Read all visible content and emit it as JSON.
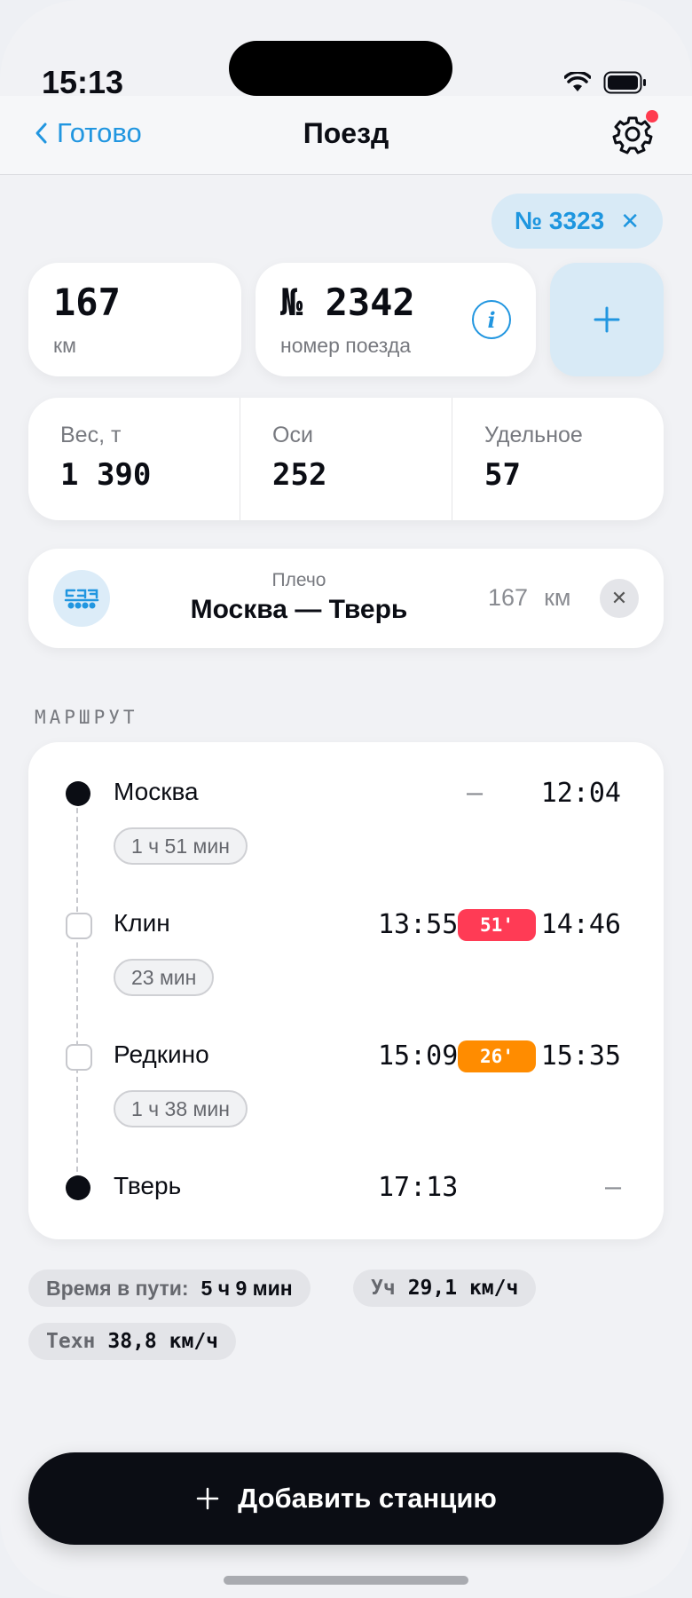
{
  "status": {
    "time": "15:13"
  },
  "nav": {
    "back_label": "Готово",
    "title": "Поезд"
  },
  "train_chip": {
    "label": "№ 3323"
  },
  "distance": {
    "value": "167",
    "unit": "км"
  },
  "train_number": {
    "value": "№ 2342",
    "label": "номер поезда"
  },
  "stats": [
    {
      "label": "Вес, т",
      "value": "1 390"
    },
    {
      "label": "Оси",
      "value": "252"
    },
    {
      "label": "Удельное",
      "value": "57"
    }
  ],
  "shoulder": {
    "caption": "Плечо",
    "route": "Москва — Тверь",
    "distance": "167",
    "unit": "км"
  },
  "route_section_label": "МАРШРУТ",
  "stops": [
    {
      "name": "Москва",
      "arrival": "—",
      "departure": "12:04",
      "marker": "filled"
    },
    {
      "name": "Клин",
      "arrival": "13:55",
      "stop_badge": "51'",
      "departure": "14:46",
      "marker": "hollow"
    },
    {
      "name": "Редкино",
      "arrival": "15:09",
      "stop_badge": "26'",
      "departure": "15:35",
      "marker": "hollow"
    },
    {
      "name": "Тверь",
      "arrival": "17:13",
      "departure": "—",
      "marker": "filled"
    }
  ],
  "segments": [
    "1 ч 51 мин",
    "23 мин",
    "1 ч 38 мин"
  ],
  "summary": {
    "travel_time_label": "Время в пути:",
    "travel_time": "5 ч 9 мин",
    "section_speed_label": "Уч",
    "section_speed": "29,1 км/ч",
    "tech_speed_label": "Техн",
    "tech_speed": "38,8 км/ч"
  },
  "add_button_label": "Добавить станцию",
  "colors": {
    "accent": "#2196e0",
    "badge_red": "#ff3b55",
    "badge_orange": "#ff8c00",
    "dark": "#0b0d14"
  },
  "icons": [
    "chevron-left-icon",
    "gear-icon",
    "close-icon",
    "info-icon",
    "plus-icon",
    "train-icon",
    "wifi-icon",
    "battery-icon",
    "cellular-icon"
  ]
}
